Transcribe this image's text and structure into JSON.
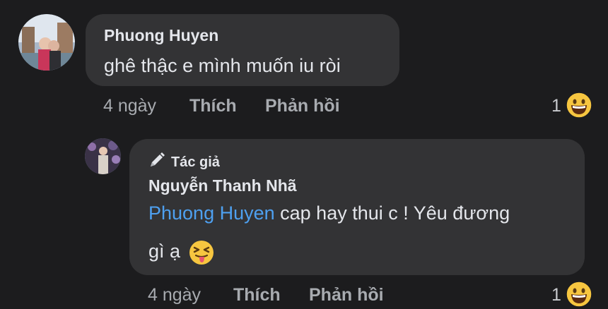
{
  "comment": {
    "author": "Phuong Huyen",
    "text": "ghê thậc e mình muốn iu ròi",
    "time": "4 ngày",
    "like_label": "Thích",
    "reply_label": "Phản hồi",
    "reaction_count": "1",
    "reaction_icon": "grinning-face-emoji"
  },
  "reply": {
    "badge_icon": "pencil-icon",
    "badge_label": "Tác giả",
    "author": "Nguyễn Thanh Nhã",
    "mention": "Phuong Huyen",
    "text_line1": " cap hay thui c ! Yêu đương",
    "text_line2": "gì ạ",
    "inline_emoji": "squinting-tongue-emoji",
    "time": "4 ngày",
    "like_label": "Thích",
    "reply_label": "Phản hồi",
    "reaction_count": "1",
    "reaction_icon": "grinning-face-emoji"
  },
  "colors": {
    "background": "#1c1c1e",
    "bubble": "#333335",
    "mention": "#4ea0f0",
    "meta_text": "#a8abb0",
    "emoji_yellow": "#f7c640"
  }
}
